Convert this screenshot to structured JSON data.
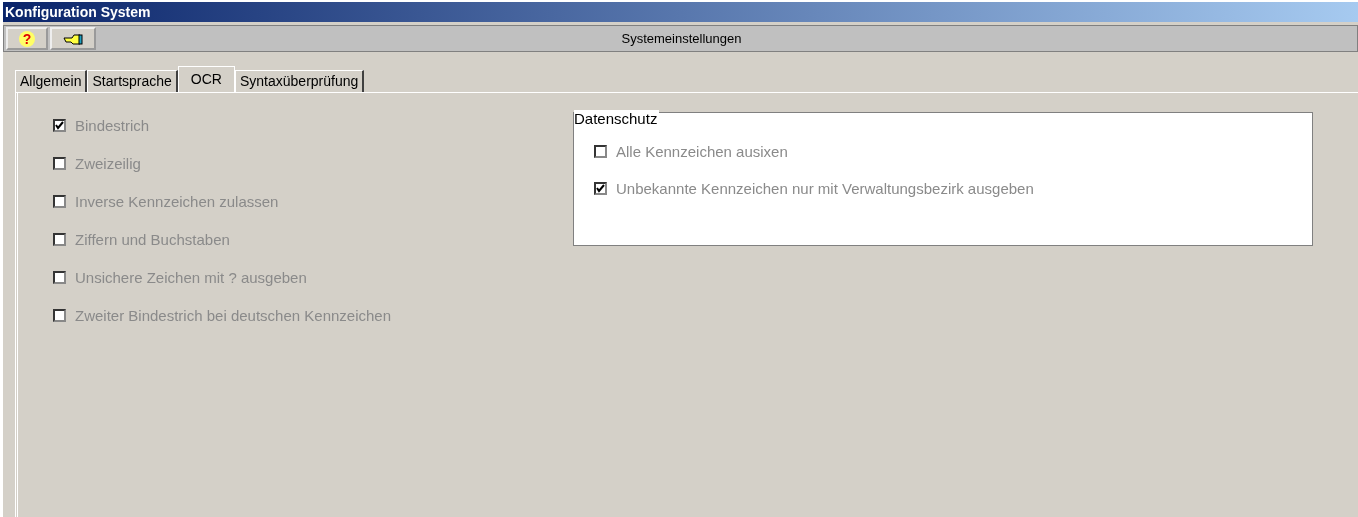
{
  "window": {
    "title": "Konfiguration System"
  },
  "toolbar": {
    "buttons": [
      {
        "kind": "help",
        "symbol": "?"
      },
      {
        "kind": "exit"
      }
    ],
    "title": "Systemeinstellungen"
  },
  "tabs": [
    {
      "label": "Allgemein",
      "selected": false
    },
    {
      "label": "Startsprache",
      "selected": false
    },
    {
      "label": "OCR",
      "selected": true
    },
    {
      "label": "Syntaxüberprüfung",
      "selected": false
    }
  ],
  "options": [
    {
      "label": "Bindestrich",
      "checked": true,
      "disabled": true
    },
    {
      "label": "Zweizeilig",
      "checked": false,
      "disabled": true
    },
    {
      "label": "Inverse Kennzeichen zulassen",
      "checked": false,
      "disabled": true
    },
    {
      "label": "Ziffern und Buchstaben",
      "checked": false,
      "disabled": true
    },
    {
      "label": "Unsichere Zeichen mit ? ausgeben",
      "checked": false,
      "disabled": true
    },
    {
      "label": "Zweiter Bindestrich bei deutschen Kennzeichen",
      "checked": false,
      "disabled": true
    }
  ],
  "privacy": {
    "title": "Datenschutz",
    "options": [
      {
        "label": "Alle Kennzeichen ausixen",
        "checked": false,
        "disabled": true
      },
      {
        "label": "Unbekannte Kennzeichen nur mit Verwaltungsbezirk ausgeben",
        "checked": true,
        "disabled": true
      }
    ]
  }
}
